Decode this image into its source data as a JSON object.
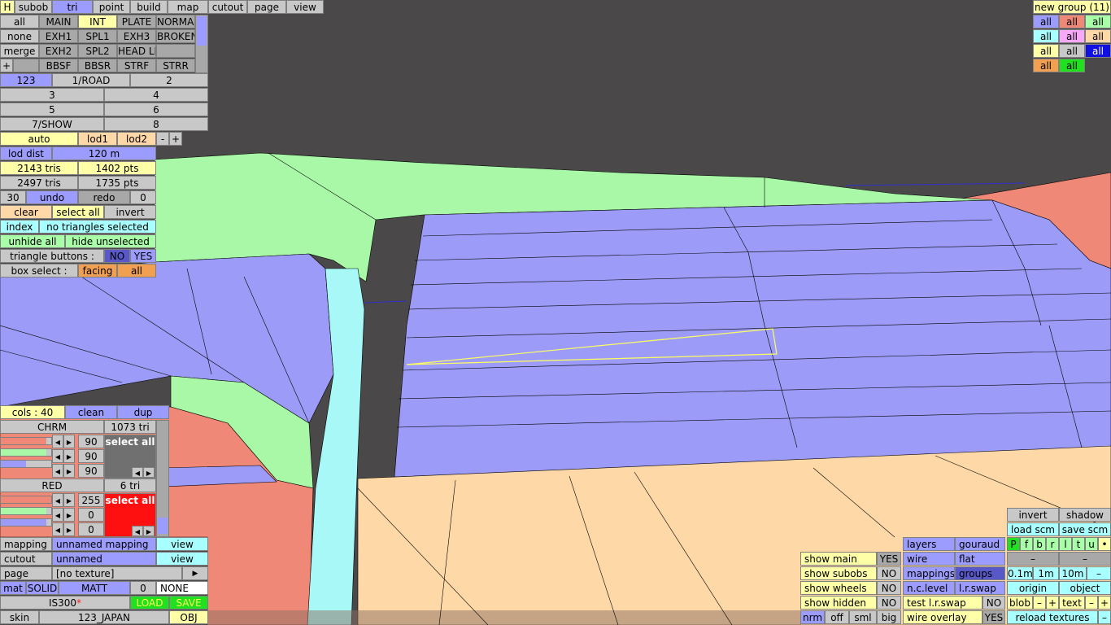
{
  "top_menu": {
    "h": "H",
    "items": [
      "subob",
      "tri",
      "point",
      "build",
      "map",
      "cutout",
      "page",
      "view"
    ]
  },
  "groups_panel": {
    "row1": [
      "all",
      "MAIN",
      "INT",
      "PLATE",
      "NORMAL"
    ],
    "row2": [
      "none",
      "EXH1",
      "SPL1",
      "EXH3",
      "BROKEN"
    ],
    "row3": [
      "merge",
      "EXH2",
      "SPL2",
      "HEAD LI",
      ""
    ],
    "row4": [
      "+",
      "",
      "BBSF",
      "BBSR",
      "STRF",
      "STRR"
    ]
  },
  "layers_panel": {
    "row1": [
      "123",
      "1/ROAD",
      "2"
    ],
    "row2": [
      "3",
      "4"
    ],
    "row3": [
      "5",
      "6"
    ],
    "row4": [
      "7/SHOW",
      "8"
    ]
  },
  "lod": {
    "auto": "auto",
    "lod1": "lod1",
    "lod2": "lod2",
    "minus": "-",
    "plus": "+"
  },
  "info": {
    "lod_dist_label": "lod dist",
    "lod_dist_value": "120 m",
    "tris_1": "2143 tris",
    "pts_1": "1402 pts",
    "tris_2": "2497 tris",
    "pts_2": "1735 pts",
    "undo_count": "30",
    "undo": "undo",
    "redo": "redo",
    "redo_count": "0",
    "clear": "clear",
    "select_all": "select all",
    "invert": "invert",
    "index": "index",
    "selection_status": "no triangles selected",
    "unhide_all": "unhide all",
    "hide_unselected": "hide unselected",
    "triangle_buttons": "triangle buttons :",
    "no": "NO",
    "yes": "YES",
    "box_select": "box select :",
    "facing": "facing",
    "all": "all"
  },
  "point_group": {
    "title": "new group (11)",
    "cells": [
      "all",
      "all",
      "all",
      "all",
      "all",
      "all",
      "all",
      "all",
      "all",
      "all",
      "all"
    ]
  },
  "color_panel": {
    "cols": "cols : 40",
    "clean": "clean",
    "dup": "dup",
    "mat1_name": "CHRM",
    "mat1_tri": "1073 tri",
    "mat1_r": "90",
    "mat1_g": "90",
    "mat1_b": "90",
    "mat1_select": "select all",
    "mat2_name": "RED",
    "mat2_tri": "6 tri",
    "mat2_r": "255",
    "mat2_g": "0",
    "mat2_b": "0",
    "mat2_select": "select all",
    "mat1_swatch": "#5c5c5c",
    "mat2_swatch": "#ff0000"
  },
  "bottom_left": {
    "mapping": "mapping",
    "mapping_value": "unnamed mapping",
    "view1": "view",
    "cutout": "cutout",
    "cutout_value": "unnamed",
    "view2": "view",
    "page": "page",
    "page_value": "[no texture]",
    "mat": "mat",
    "solid": "SOLID",
    "matt": "MATT",
    "mat_num": "0",
    "mat_none": "NONE",
    "model": "IS300",
    "star": "*",
    "load": "LOAD",
    "save": "SAVE",
    "skin": "skin",
    "skin_value": "123_JAPAN",
    "obj": "OBJ"
  },
  "show_panel": {
    "show_main": "show main",
    "show_main_v": "YES",
    "show_subobs": "show subobs",
    "show_subobs_v": "NO",
    "show_wheels": "show wheels",
    "show_wheels_v": "NO",
    "show_hidden": "show hidden",
    "show_hidden_v": "NO",
    "nrm": "nrm",
    "off": "off",
    "sml": "sml",
    "big": "big"
  },
  "render_panel": {
    "layers": "layers",
    "gouraud": "gouraud",
    "wire": "wire",
    "flat": "flat",
    "mappings": "mappings",
    "groups": "groups",
    "nclevel": "n.c.level",
    "lrswap": "l.r.swap",
    "test_lrswap": "test l.r.swap",
    "test_lrswap_v": "NO",
    "wire_overlay": "wire overlay",
    "wire_overlay_v": "YES"
  },
  "view_panel": {
    "invert": "invert",
    "shadow": "shadow",
    "load_scm": "load scm",
    "save_scm": "save scm",
    "dirs": [
      "P",
      "f",
      "b",
      "r",
      "l",
      "t",
      "u",
      "•"
    ],
    "minus1": "–",
    "minus2": "–",
    "d01": "0.1m",
    "d1": "1m",
    "d10": "10m",
    "dm": "–",
    "origin": "origin",
    "object": "object",
    "blob": "blob",
    "blob_m": "–",
    "blob_p": "+",
    "text": "text",
    "text_m": "–",
    "text_p": "+",
    "reload": "reload textures",
    "reload_m": "–"
  }
}
